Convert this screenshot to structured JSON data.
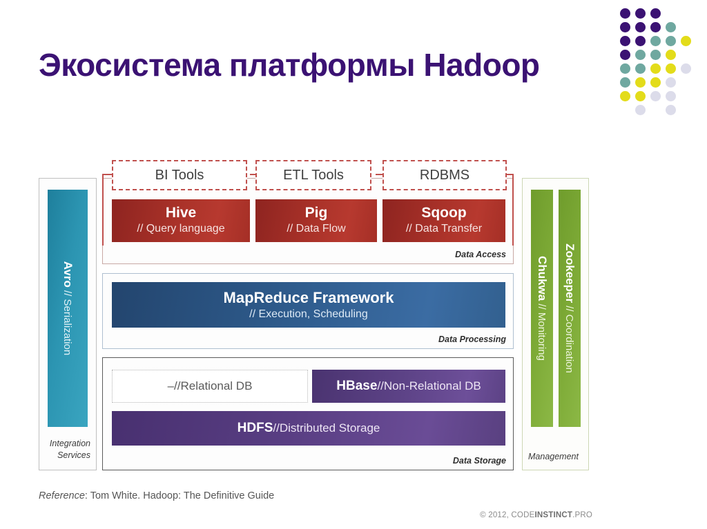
{
  "slide": {
    "title": "Экосистема платформы Hadoop"
  },
  "logo": {
    "name": "dot-grid-logo",
    "colors": {
      "purple": "#3b1273",
      "teal": "#6fa8a0",
      "yellow": "#e3dc1a",
      "lavender": "#dcdcea"
    },
    "dots": [
      {
        "col": 0,
        "row": 0,
        "color": "#3b1273"
      },
      {
        "col": 1,
        "row": 0,
        "color": "#3b1273"
      },
      {
        "col": 2,
        "row": 0,
        "color": "#3b1273"
      },
      {
        "col": 0,
        "row": 1,
        "color": "#3b1273"
      },
      {
        "col": 1,
        "row": 1,
        "color": "#3b1273"
      },
      {
        "col": 2,
        "row": 1,
        "color": "#3b1273"
      },
      {
        "col": 3,
        "row": 1,
        "color": "#6fa8a0"
      },
      {
        "col": 0,
        "row": 2,
        "color": "#3b1273"
      },
      {
        "col": 1,
        "row": 2,
        "color": "#3b1273"
      },
      {
        "col": 2,
        "row": 2,
        "color": "#6fa8a0"
      },
      {
        "col": 3,
        "row": 2,
        "color": "#6fa8a0"
      },
      {
        "col": 4,
        "row": 2,
        "color": "#e3dc1a"
      },
      {
        "col": 0,
        "row": 3,
        "color": "#3b1273"
      },
      {
        "col": 1,
        "row": 3,
        "color": "#6fa8a0"
      },
      {
        "col": 2,
        "row": 3,
        "color": "#6fa8a0"
      },
      {
        "col": 3,
        "row": 3,
        "color": "#e3dc1a"
      },
      {
        "col": 0,
        "row": 4,
        "color": "#6fa8a0"
      },
      {
        "col": 1,
        "row": 4,
        "color": "#6fa8a0"
      },
      {
        "col": 2,
        "row": 4,
        "color": "#e3dc1a"
      },
      {
        "col": 3,
        "row": 4,
        "color": "#e3dc1a"
      },
      {
        "col": 4,
        "row": 4,
        "color": "#dcdcea"
      },
      {
        "col": 0,
        "row": 5,
        "color": "#6fa8a0"
      },
      {
        "col": 1,
        "row": 5,
        "color": "#e3dc1a"
      },
      {
        "col": 2,
        "row": 5,
        "color": "#e3dc1a"
      },
      {
        "col": 3,
        "row": 5,
        "color": "#dcdcea"
      },
      {
        "col": 0,
        "row": 6,
        "color": "#e3dc1a"
      },
      {
        "col": 1,
        "row": 6,
        "color": "#e3dc1a"
      },
      {
        "col": 2,
        "row": 6,
        "color": "#dcdcea"
      },
      {
        "col": 3,
        "row": 6,
        "color": "#dcdcea"
      },
      {
        "col": 1,
        "row": 7,
        "color": "#dcdcea"
      },
      {
        "col": 3,
        "row": 7,
        "color": "#dcdcea"
      }
    ]
  },
  "diagram": {
    "integration": {
      "label_line1": "Integration",
      "label_line2": "Services",
      "bar": {
        "name": "Avro",
        "separator": " // ",
        "subtitle": "Serialization",
        "color": "#2c95b2"
      }
    },
    "management": {
      "label": "Management",
      "bars": [
        {
          "name": "Chukwa",
          "separator": " // ",
          "subtitle": "Monitoring",
          "color": "#7daa36"
        },
        {
          "name": "Zookeeper",
          "separator": " // ",
          "subtitle": "Coordination",
          "color": "#7daa36"
        }
      ]
    },
    "tool_boxes": [
      {
        "label": "BI  Tools",
        "border_color": "#c0504d"
      },
      {
        "label": "ETL Tools",
        "border_color": "#c0504d"
      },
      {
        "label": "RDBMS",
        "border_color": "#c0504d"
      }
    ],
    "layers": [
      {
        "label": "Data Access",
        "accent": "#aa3229",
        "items": [
          {
            "name": "Hive",
            "subtitle": "// Query language"
          },
          {
            "name": "Pig",
            "subtitle": "// Data Flow"
          },
          {
            "name": "Sqoop",
            "subtitle": "// Data Transfer"
          }
        ]
      },
      {
        "label": "Data Processing",
        "accent": "#2e5b8c",
        "items": [
          {
            "name": "MapReduce Framework",
            "subtitle": "// Execution, Scheduling"
          }
        ]
      },
      {
        "label": "Data Storage",
        "accent": "#5a3f84",
        "items": [
          {
            "name": "–",
            "separator": " // ",
            "subtitle": "Relational DB"
          },
          {
            "name": "HBase",
            "separator": " // ",
            "subtitle": "Non-Relational DB"
          },
          {
            "name": "HDFS",
            "separator": " // ",
            "subtitle": "Distributed Storage"
          }
        ]
      }
    ]
  },
  "footer": {
    "reference_word": "Reference",
    "reference_text": ": Tom White. Hadoop: The Definitive Guide",
    "copyright_prefix": "© 2012, CODE",
    "copyright_brand": "INSTINCT",
    "copyright_suffix": ".PRO"
  }
}
